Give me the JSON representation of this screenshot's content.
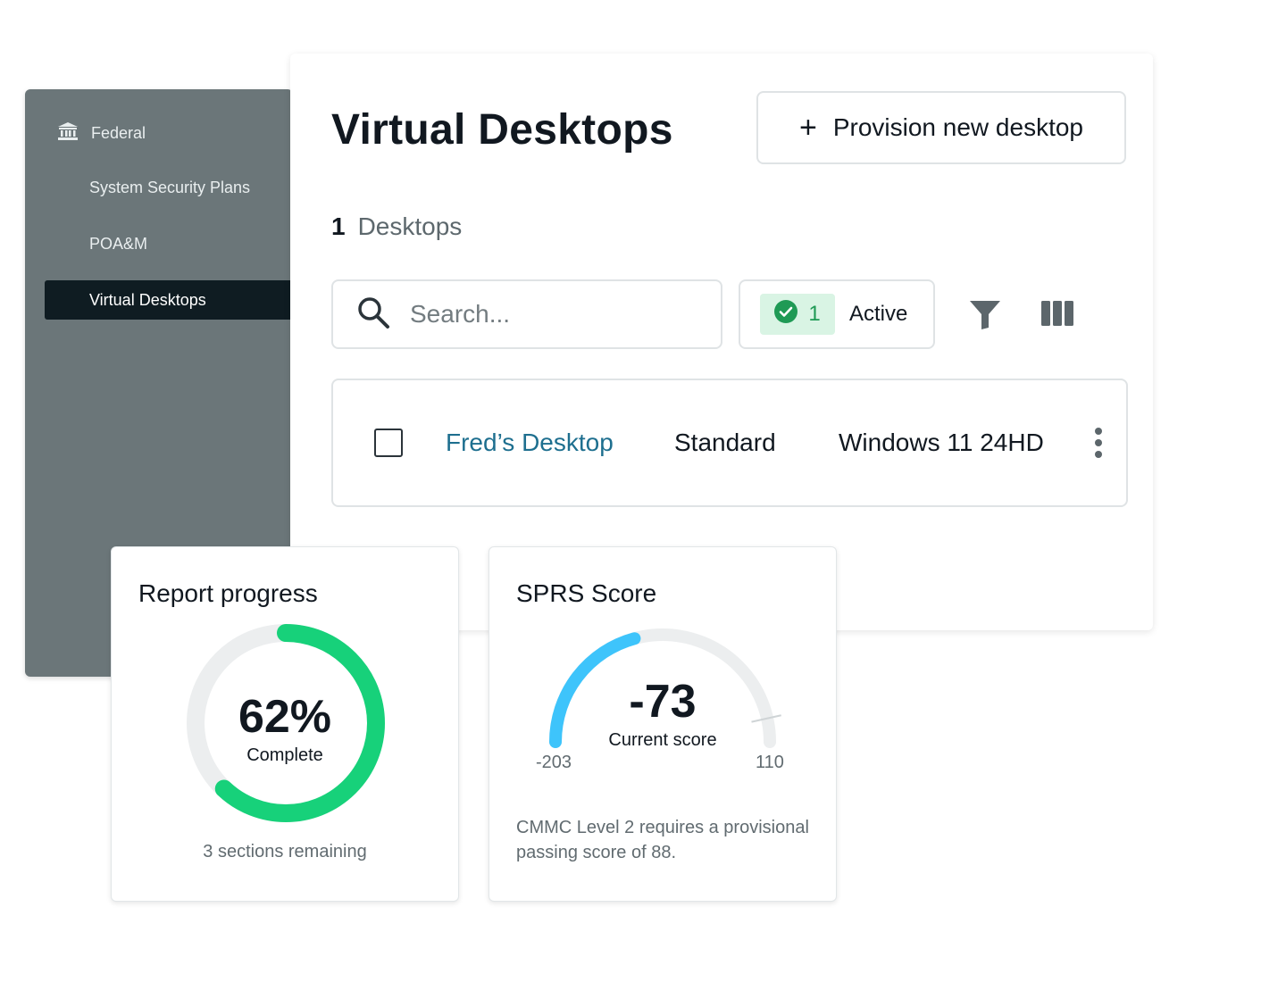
{
  "sidebar": {
    "header": "Federal",
    "header_icon": "bank-icon",
    "items": [
      {
        "label": "System Security Plans",
        "active": false
      },
      {
        "label": "POA&M",
        "active": false
      },
      {
        "label": "Virtual Desktops",
        "active": true
      }
    ]
  },
  "main": {
    "title": "Virtual Desktops",
    "provision_button": {
      "icon": "plus-icon",
      "label": "Provision new desktop"
    },
    "count": {
      "number": "1",
      "label": "Desktops"
    },
    "search": {
      "placeholder": "Search...",
      "value": ""
    },
    "active_filter": {
      "count": "1",
      "label": "Active",
      "icon": "check-circle-icon"
    },
    "toolbar_icons": [
      "filter-icon",
      "columns-icon"
    ],
    "rows": [
      {
        "name": "Fred’s Desktop",
        "tier": "Standard",
        "os": "Windows 11 24HD"
      }
    ]
  },
  "report_progress": {
    "title": "Report progress",
    "percent_label": "62%",
    "percent_value": 0.62,
    "sub": "Complete",
    "footer": "3 sections remaining"
  },
  "sprs_score": {
    "title": "SPRS Score",
    "value": "-73",
    "min": "-203",
    "max": "110",
    "sub": "Current score",
    "note": "CMMC Level 2 requires a provisional passing score of 88."
  },
  "colors": {
    "sidebar_bg": "#6b7679",
    "sidebar_active_bg": "#0f1c22",
    "progress_green": "#17d17a",
    "gauge_blue": "#3ec4fb",
    "link_blue": "#1e6f8f",
    "badge_bg": "#d9f4e4",
    "badge_green": "#1f9a55"
  }
}
